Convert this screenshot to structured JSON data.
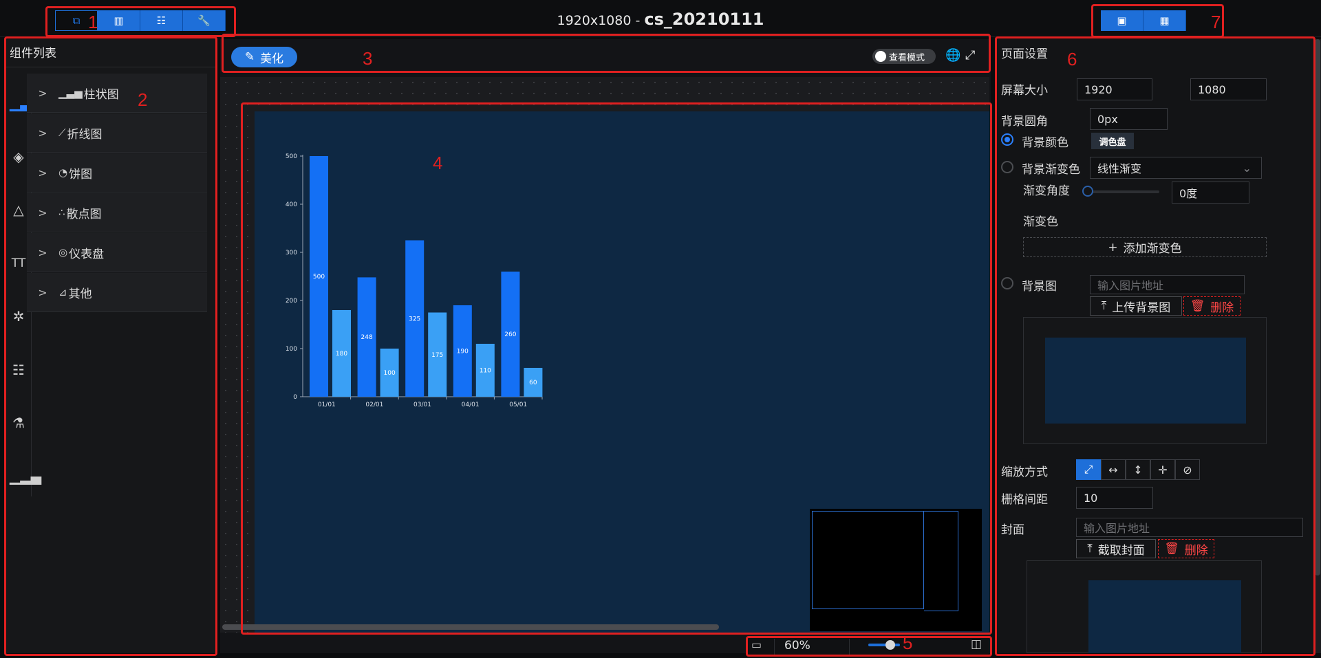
{
  "header": {
    "resolution": "1920x1080 - ",
    "project_name": "cs_20210111",
    "left_tools": [
      "layers-icon",
      "board-icon",
      "sliders-icon",
      "wrench-icon"
    ],
    "right_tools": [
      "preview-icon",
      "qrcode-icon"
    ]
  },
  "annotations": [
    "1",
    "2",
    "3",
    "4",
    "5",
    "6",
    "7"
  ],
  "left_panel": {
    "title": "组件列表",
    "icons": [
      "bar-chart-icon",
      "diamond-icon",
      "pyramid-icon",
      "text-icon",
      "slack-icon",
      "sliders-icon",
      "flask-icon",
      "stats-icon"
    ],
    "items": [
      {
        "label": "柱状图",
        "icon": "bar-chart-icon"
      },
      {
        "label": "折线图",
        "icon": "line-chart-icon"
      },
      {
        "label": "饼图",
        "icon": "pie-chart-icon"
      },
      {
        "label": "散点图",
        "icon": "scatter-icon"
      },
      {
        "label": "仪表盘",
        "icon": "gauge-icon"
      },
      {
        "label": "其他",
        "icon": "other-icon"
      }
    ]
  },
  "toolbar": {
    "beautify_label": "美化",
    "view_mode_label": "查看模式"
  },
  "chart_data": {
    "type": "bar",
    "categories": [
      "01/01",
      "02/01",
      "03/01",
      "04/01",
      "05/01"
    ],
    "series": [
      {
        "values": [
          500,
          248,
          325,
          190,
          260
        ],
        "color": "#1470f5"
      },
      {
        "values": [
          180,
          100,
          175,
          110,
          60
        ],
        "color": "#3aa0f5"
      }
    ],
    "yticks": [
      0,
      100,
      200,
      300,
      400,
      500
    ],
    "ylim": [
      0,
      500
    ]
  },
  "bottom": {
    "zoom": "60%"
  },
  "right_panel": {
    "title": "页面设置",
    "screen_size_label": "屏幕大小",
    "width": "1920",
    "height": "1080",
    "radius_label": "背景圆角",
    "radius": "0px",
    "bg_color_label": "背景颜色",
    "palette_label": "调色盘",
    "gradient_label": "背景渐变色",
    "gradient_type": "线性渐变",
    "angle_label": "渐变角度",
    "angle_value": "0度",
    "gradient_color_label": "渐变色",
    "add_gradient": "添加渐变色",
    "bg_image_label": "背景图",
    "image_placeholder": "输入图片地址",
    "upload_bg": "上传背景图",
    "delete": "删除",
    "scale_label": "缩放方式",
    "grid_label": "栅格间距",
    "grid_value": "10",
    "cover_label": "封面",
    "cover_placeholder": "输入图片地址",
    "capture_cover": "截取封面"
  },
  "colors": {
    "accent": "#1e6fd9",
    "annotation": "#e02020",
    "stage": "#0e2843"
  }
}
